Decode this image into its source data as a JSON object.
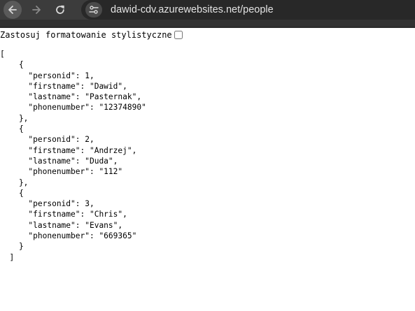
{
  "browser": {
    "url": "dawid-cdv.azurewebsites.net/people"
  },
  "page": {
    "pretty_print_label": "Zastosuj formatowanie stylistyczne",
    "pretty_print_checked": false
  },
  "json_lines": [
    "[",
    "    {",
    "      \"personid\": 1,",
    "      \"firstname\": \"Dawid\",",
    "      \"lastname\": \"Pasternak\",",
    "      \"phonenumber\": \"12374890\"",
    "    },",
    "    {",
    "      \"personid\": 2,",
    "      \"firstname\": \"Andrzej\",",
    "      \"lastname\": \"Duda\",",
    "      \"phonenumber\": \"112\"",
    "    },",
    "    {",
    "      \"personid\": 3,",
    "      \"firstname\": \"Chris\",",
    "      \"lastname\": \"Evans\",",
    "      \"phonenumber\": \"669365\"",
    "    }",
    "  ]"
  ]
}
